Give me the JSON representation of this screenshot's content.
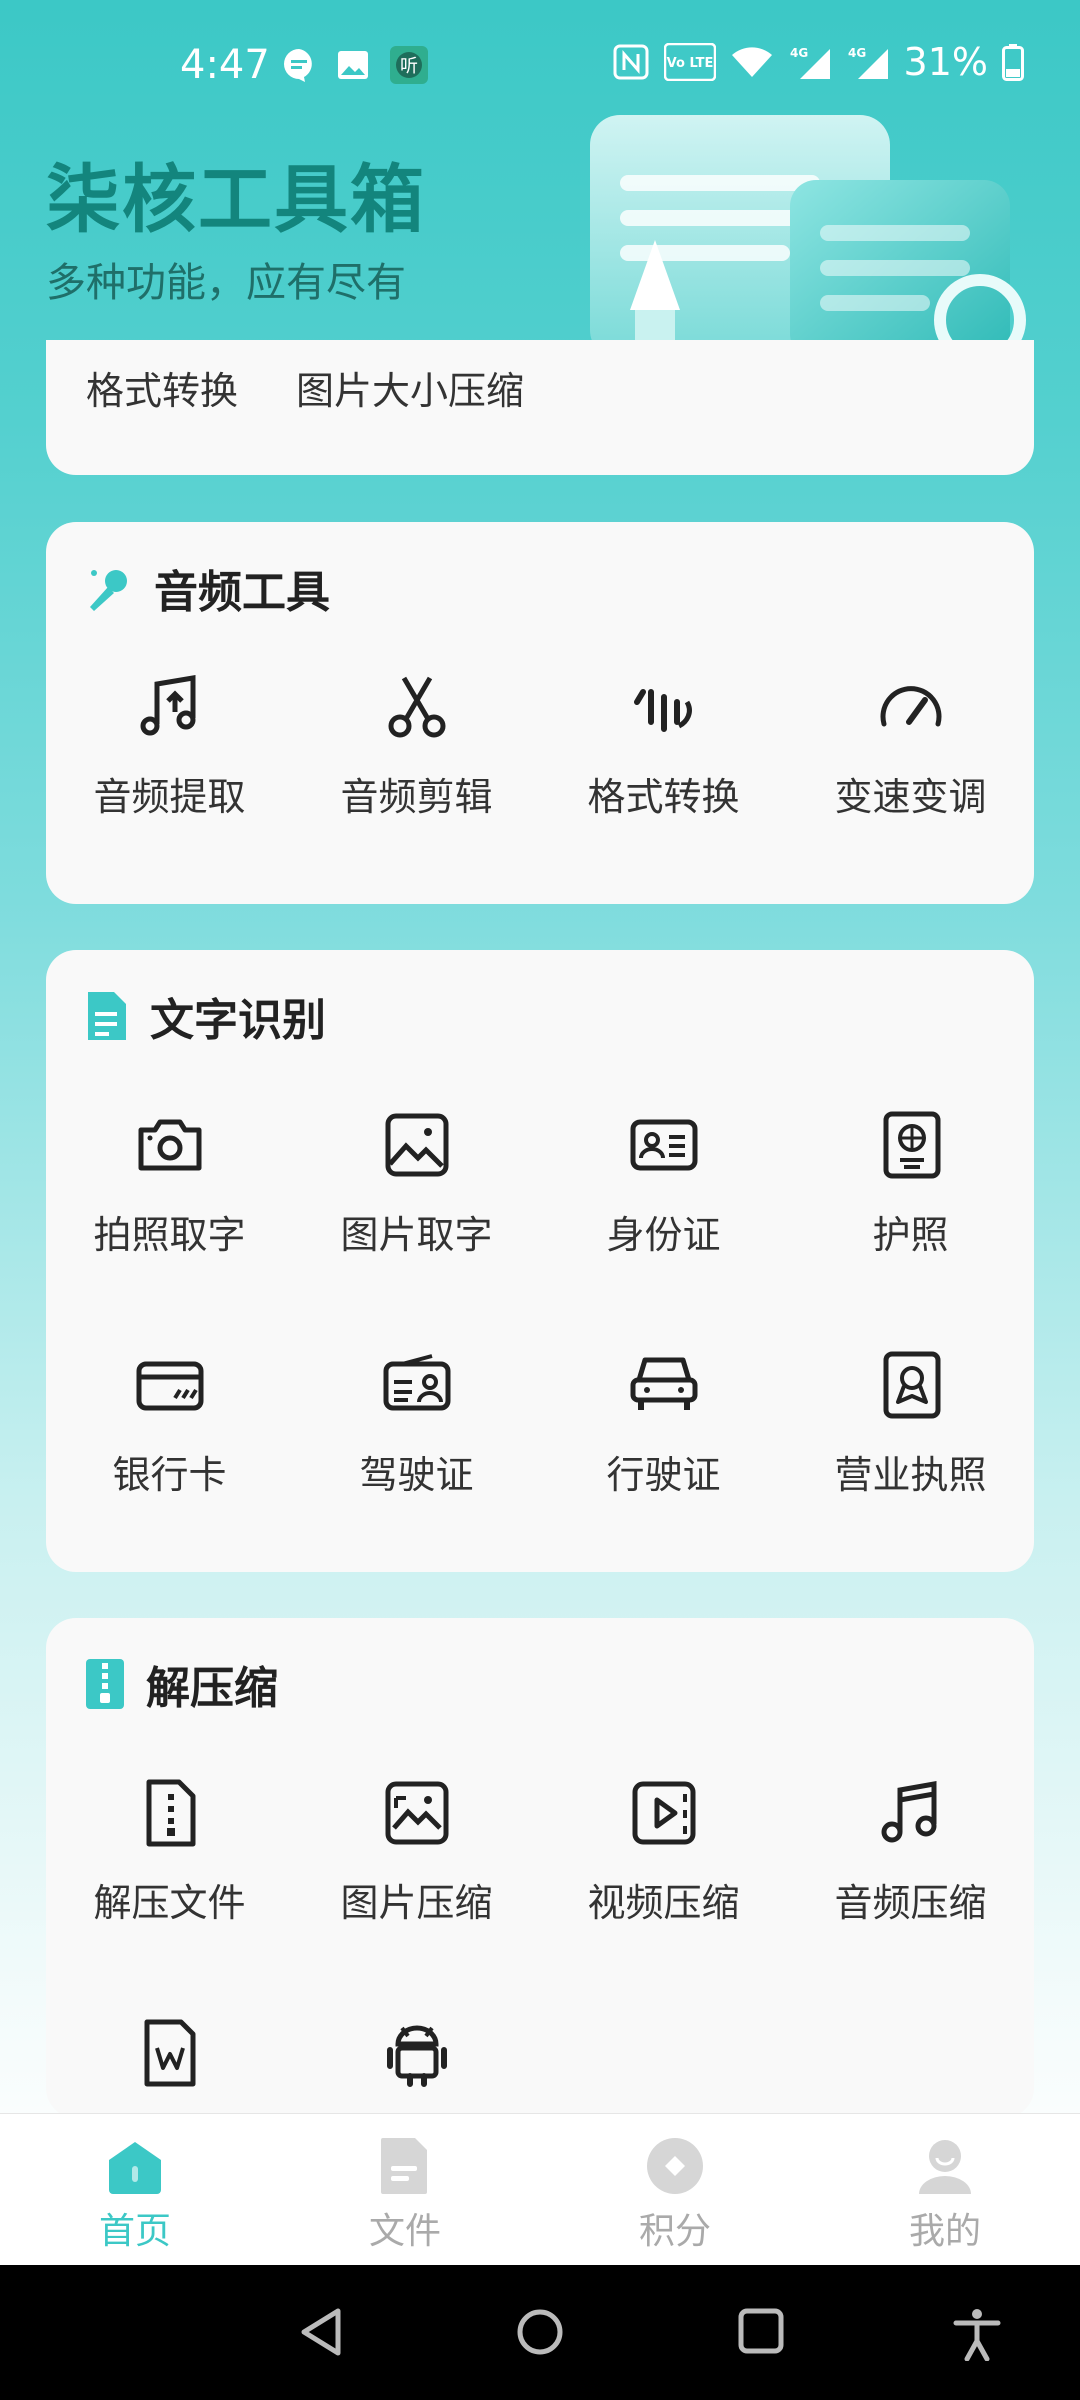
{
  "status": {
    "time": "4:47",
    "battery": "31%",
    "network": "4G",
    "volte": "Vo LTE",
    "ting_badge": "听",
    "icons": [
      "message-icon",
      "image-icon",
      "ting-icon",
      "nfc-icon",
      "volte-icon",
      "wifi-icon",
      "signal-4g-icon",
      "signal-4g-icon",
      "battery-icon"
    ]
  },
  "header": {
    "title": "柒核工具箱",
    "subtitle": "多种功能，应有尽有"
  },
  "top_card": {
    "items": [
      "格式转换",
      "图片大小压缩"
    ]
  },
  "audio": {
    "title": "音频工具",
    "items": [
      {
        "label": "音频提取",
        "icon": "music-upload-icon"
      },
      {
        "label": "音频剪辑",
        "icon": "scissors-icon"
      },
      {
        "label": "格式转换",
        "icon": "waveform-icon"
      },
      {
        "label": "变速变调",
        "icon": "speedometer-icon"
      }
    ]
  },
  "ocr": {
    "title": "文字识别",
    "items": [
      {
        "label": "拍照取字",
        "icon": "camera-icon"
      },
      {
        "label": "图片取字",
        "icon": "picture-icon"
      },
      {
        "label": "身份证",
        "icon": "id-card-icon"
      },
      {
        "label": "护照",
        "icon": "passport-icon"
      },
      {
        "label": "银行卡",
        "icon": "bank-card-icon"
      },
      {
        "label": "驾驶证",
        "icon": "driver-license-icon"
      },
      {
        "label": "行驶证",
        "icon": "car-icon"
      },
      {
        "label": "营业执照",
        "icon": "business-license-icon"
      }
    ]
  },
  "zip": {
    "title": "解压缩",
    "items": [
      {
        "label": "解压文件",
        "icon": "zip-file-icon"
      },
      {
        "label": "图片压缩",
        "icon": "image-compress-icon"
      },
      {
        "label": "视频压缩",
        "icon": "video-compress-icon"
      },
      {
        "label": "音频压缩",
        "icon": "music-note-icon"
      },
      {
        "label": "",
        "icon": "word-doc-icon"
      },
      {
        "label": "",
        "icon": "android-icon"
      }
    ]
  },
  "bottom_nav": [
    {
      "label": "首页",
      "icon": "home-icon",
      "active": true
    },
    {
      "label": "文件",
      "icon": "file-icon",
      "active": false
    },
    {
      "label": "积分",
      "icon": "points-icon",
      "active": false
    },
    {
      "label": "我的",
      "icon": "profile-icon",
      "active": false
    }
  ],
  "colors": {
    "accent": "#3cc8c6",
    "title": "#13857d",
    "inactive": "#aaaaaa"
  }
}
